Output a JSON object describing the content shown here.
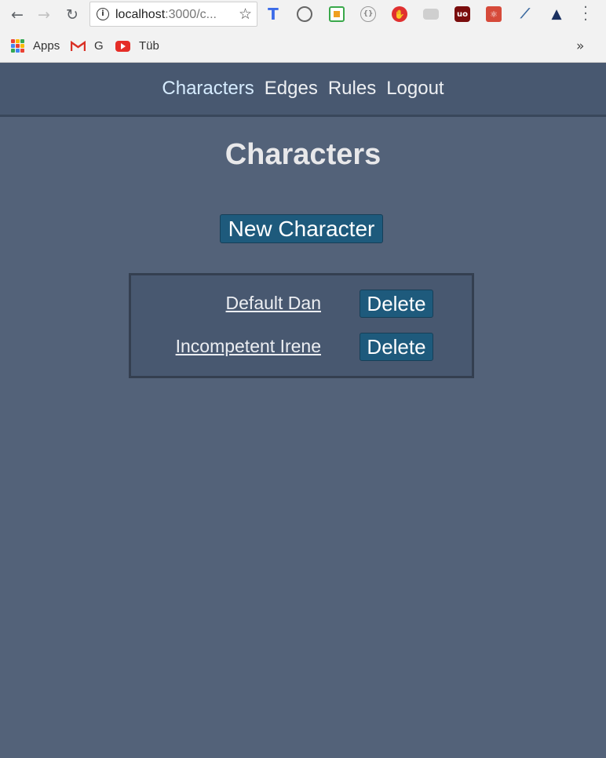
{
  "browser": {
    "url_host": "localhost",
    "url_rest": ":3000/c...",
    "bookmarks": {
      "apps_label": "Apps",
      "gmail_label": "G",
      "youtube_label": "Tüb"
    },
    "extensions": [
      "typo-icon",
      "rocket-icon",
      "color-picker-icon",
      "json-icon",
      "stop-hand-icon",
      "cloud-icon",
      "ublock-icon",
      "react-devtools-icon",
      "eyedropper-icon",
      "axe-icon"
    ],
    "colors": {
      "accent": "#1e5a7c"
    }
  },
  "nav": {
    "characters": "Characters",
    "edges": "Edges",
    "rules": "Rules",
    "logout": "Logout"
  },
  "page": {
    "title": "Characters",
    "new_button": "New Character",
    "characters": [
      {
        "name": "Default Dan",
        "delete_label": "Delete"
      },
      {
        "name": "Incompetent Irene",
        "delete_label": "Delete"
      }
    ]
  }
}
